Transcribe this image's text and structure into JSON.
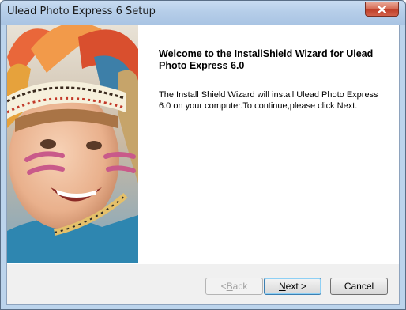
{
  "window": {
    "title": "Ulead Photo Express 6 Setup"
  },
  "welcome": {
    "heading": "Welcome to the InstallShield Wizard for Ulead Photo Express 6.0",
    "body": "The Install Shield Wizard will install Ulead Photo Express 6.0 on your computer.To continue,please click Next."
  },
  "buttons": {
    "back_prefix": "< ",
    "back_accel": "B",
    "back_rest": "ack",
    "back_enabled": false,
    "next_accel": "N",
    "next_rest": "ext >",
    "next_default": true,
    "cancel": "Cancel"
  },
  "banner": {
    "image": "child-with-face-paint-and-feather-headdress"
  },
  "colors": {
    "titlebar": "#b6cee9",
    "close_button": "#c0402a",
    "dialog_background": "#f0f0f0",
    "banner_background": "#ffffff"
  }
}
